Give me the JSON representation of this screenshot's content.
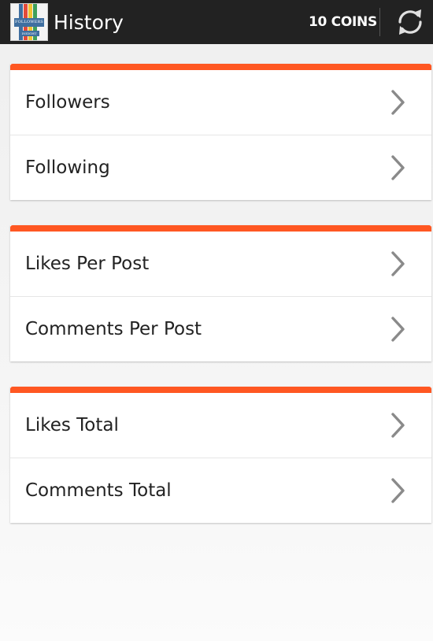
{
  "header": {
    "title": "History",
    "coins": "10 COINS",
    "logo_text_top": "FOLLOWERS",
    "logo_text_bottom": "INSIGHT",
    "refresh_icon": "refresh-icon"
  },
  "colors": {
    "appbar": "#222222",
    "accent": "#ff5722",
    "text": "#222222",
    "chevron": "#8a8a8a",
    "logo_stripes": [
      "#3f6fa0",
      "#e34b3a",
      "#f2c230",
      "#3fa05a"
    ]
  },
  "sections": [
    {
      "items": [
        {
          "label": "Followers",
          "icon": "chevron-right-icon"
        },
        {
          "label": "Following",
          "icon": "chevron-right-icon"
        }
      ]
    },
    {
      "items": [
        {
          "label": "Likes Per Post",
          "icon": "chevron-right-icon"
        },
        {
          "label": "Comments Per Post",
          "icon": "chevron-right-icon"
        }
      ]
    },
    {
      "items": [
        {
          "label": "Likes Total",
          "icon": "chevron-right-icon"
        },
        {
          "label": "Comments Total",
          "icon": "chevron-right-icon"
        }
      ]
    }
  ]
}
